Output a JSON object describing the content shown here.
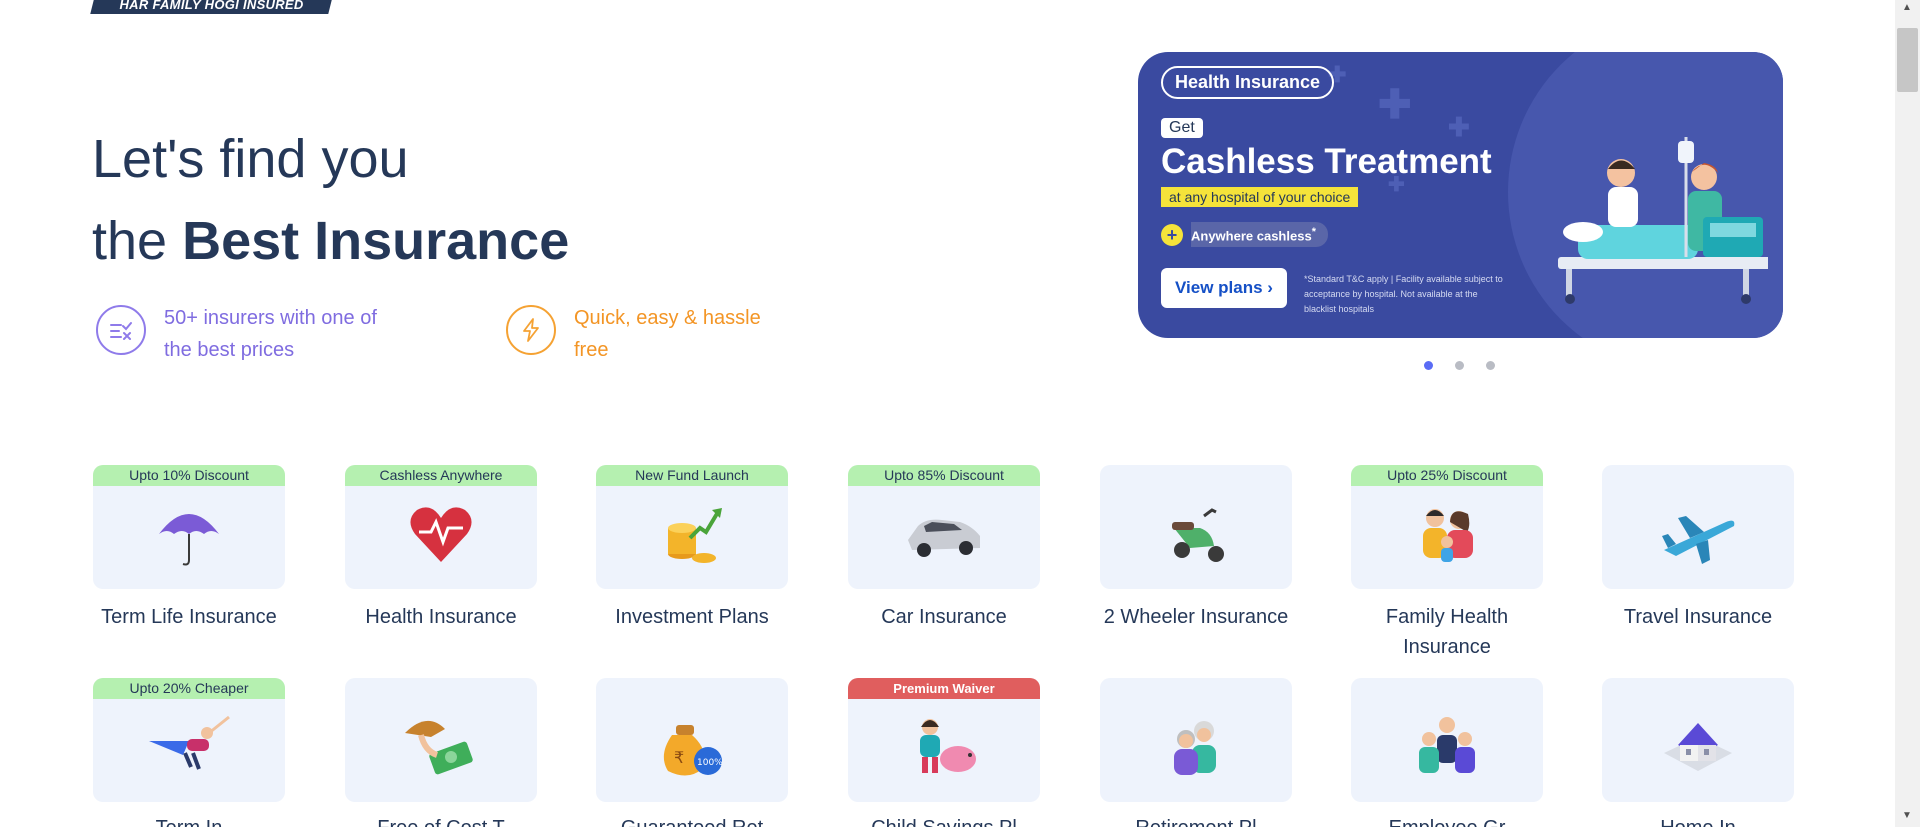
{
  "header": {
    "logo_text": "HAR FAMILY HOGI INSURED"
  },
  "hero": {
    "line1": "Let's find you",
    "line2_prefix": "the ",
    "line2_bold": "Best Insurance"
  },
  "features": [
    {
      "text": "50+ insurers with one of the best prices",
      "icon": "compare-icon"
    },
    {
      "text": "Quick, easy & hassle free",
      "icon": "lightning-icon"
    }
  ],
  "banner": {
    "pill": "Health Insurance",
    "get": "Get",
    "headline": "Cashless Treatment",
    "subline": "at any hospital of your choice",
    "cashless": "Anywhere cashless",
    "cashless_mark": "*",
    "cta": "View plans",
    "cta_icon": "chevron-right-icon",
    "terms": "*Standard T&C apply | Facility available subject to acceptance by hospital. Not available at the blacklist hospitals"
  },
  "carousel": {
    "total": 3,
    "active": 1
  },
  "products": [
    {
      "label": "Term Life Insurance",
      "tag": "Upto 10% Discount",
      "icon": "umbrella-icon"
    },
    {
      "label": "Health Insurance",
      "tag": "Cashless Anywhere",
      "icon": "heart-pulse-icon"
    },
    {
      "label": "Investment Plans",
      "tag": "New Fund Launch",
      "icon": "coins-growth-icon"
    },
    {
      "label": "Car Insurance",
      "tag": "Upto 85% Discount",
      "icon": "car-icon"
    },
    {
      "label": "2 Wheeler Insurance",
      "tag": "",
      "icon": "scooter-icon"
    },
    {
      "label": "Family Health Insurance",
      "tag": "Upto 25% Discount",
      "icon": "family-icon"
    },
    {
      "label": "Travel Insurance",
      "tag": "",
      "icon": "airplane-icon"
    },
    {
      "label": "Term Insurance",
      "tag": "Upto 20% Cheaper",
      "icon": "superhero-icon"
    },
    {
      "label": "Free of Cost Term",
      "tag": "",
      "icon": "money-return-icon"
    },
    {
      "label": "Guaranteed Return Plans",
      "tag": "",
      "icon": "money-bag-icon"
    },
    {
      "label": "Child Savings Plans",
      "tag": "Premium Waiver",
      "tag_style": "red",
      "icon": "child-piggybank-icon"
    },
    {
      "label": "Retirement Plans",
      "tag": "",
      "icon": "elderly-couple-icon"
    },
    {
      "label": "Employee Group Health Insurance",
      "tag": "",
      "icon": "employees-icon"
    },
    {
      "label": "Home Insurance",
      "tag": "",
      "icon": "house-icon"
    }
  ],
  "row2_visible_labels": [
    "Term In",
    "Free of Cost T",
    "Guaranteed Ret",
    "Child Savings Pl",
    "Retirement Pl",
    "Employee Gr",
    "Home In"
  ]
}
